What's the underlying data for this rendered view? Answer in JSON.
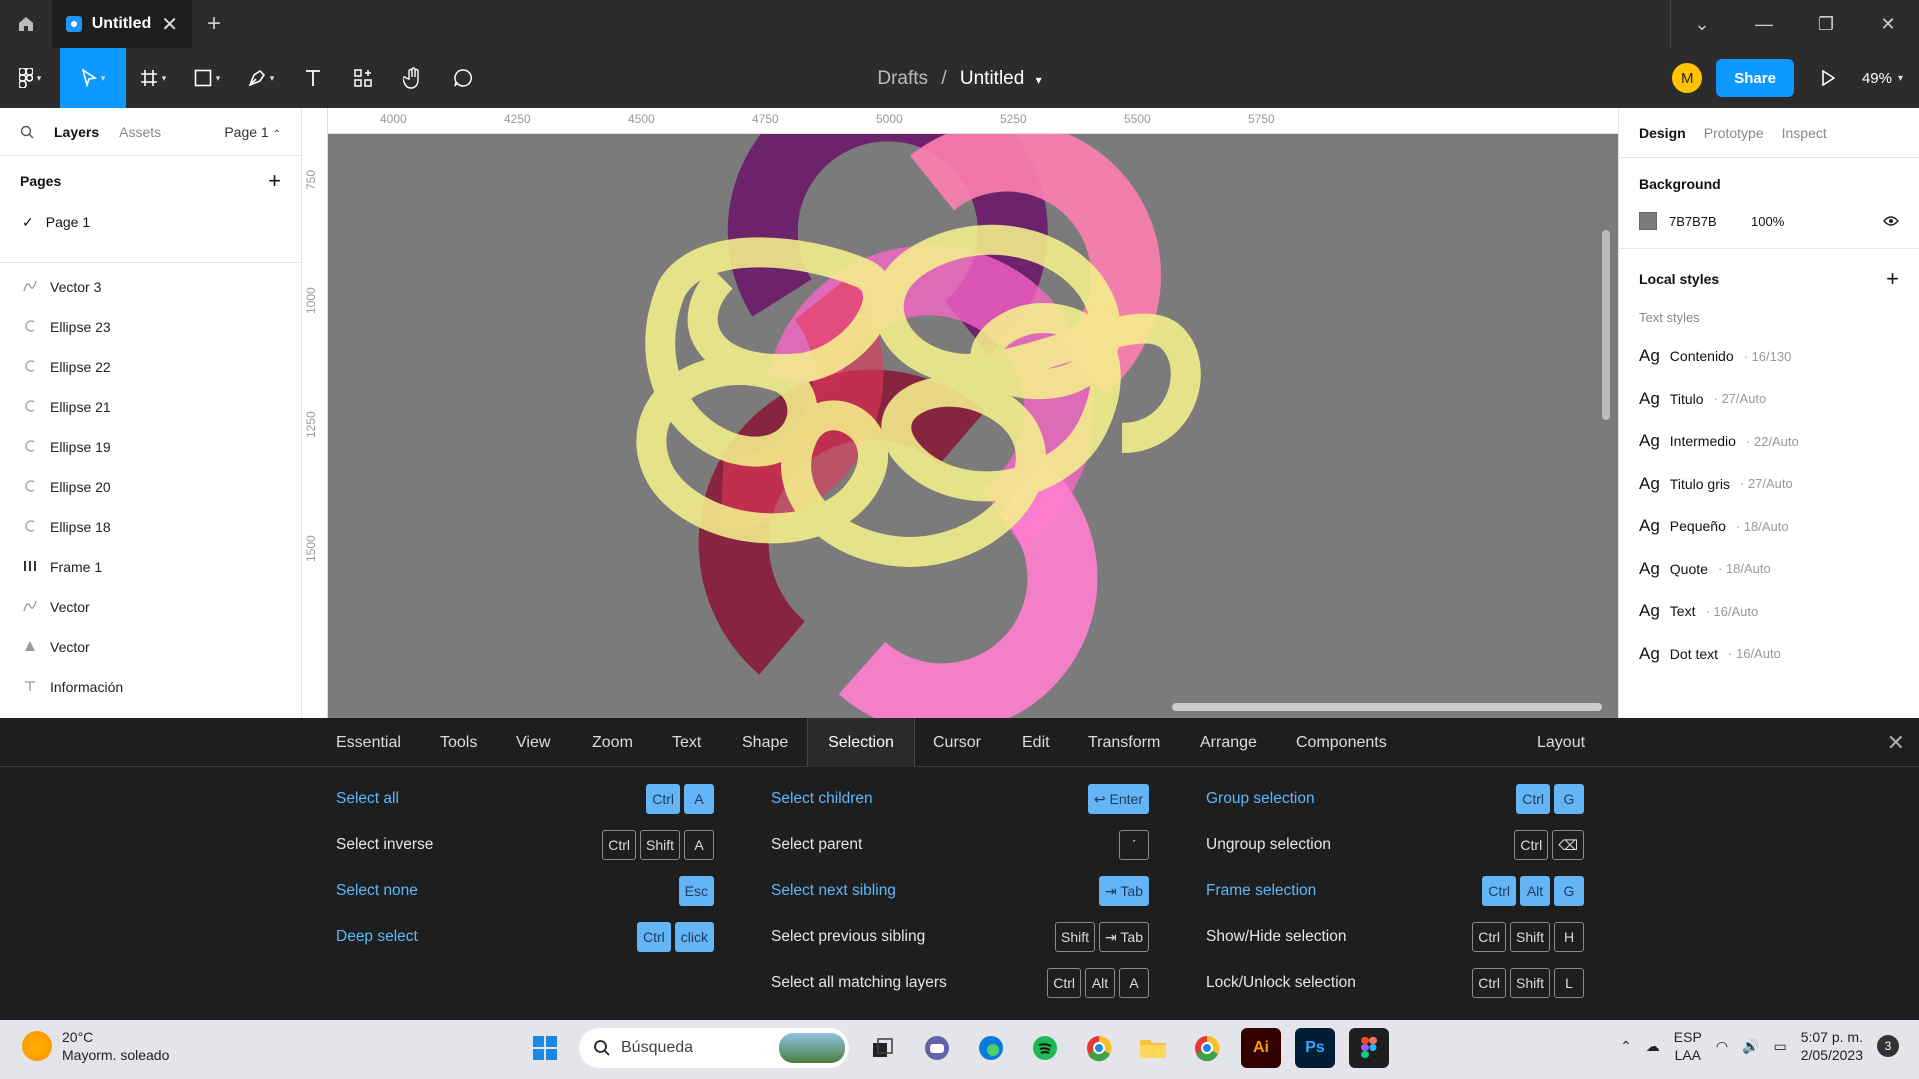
{
  "titlebar": {
    "tab_title": "Untitled",
    "close_glyph": "✕",
    "add_glyph": "+"
  },
  "toolbar": {
    "breadcrumb_parent": "Drafts",
    "breadcrumb_sep": "/",
    "file_name": "Untitled",
    "avatar_initial": "M",
    "share_label": "Share",
    "zoom": "49%"
  },
  "left_panel": {
    "tabs": {
      "layers": "Layers",
      "assets": "Assets",
      "page_selector": "Page 1"
    },
    "pages_heading": "Pages",
    "pages": [
      "Page 1"
    ],
    "layers": [
      {
        "name": "Vector 3",
        "icon": "vector-icon"
      },
      {
        "name": "Ellipse 23",
        "icon": "ellipse-arc-icon"
      },
      {
        "name": "Ellipse 22",
        "icon": "ellipse-arc-icon"
      },
      {
        "name": "Ellipse 21",
        "icon": "ellipse-arc-icon"
      },
      {
        "name": "Ellipse 19",
        "icon": "ellipse-arc-icon"
      },
      {
        "name": "Ellipse 20",
        "icon": "ellipse-arc-icon"
      },
      {
        "name": "Ellipse 18",
        "icon": "ellipse-arc-icon"
      },
      {
        "name": "Frame 1",
        "icon": "frame-icon"
      },
      {
        "name": "Vector",
        "icon": "vector-icon"
      },
      {
        "name": "Vector",
        "icon": "triangle-icon"
      },
      {
        "name": "Información",
        "icon": "text-icon"
      }
    ]
  },
  "canvas": {
    "background": "#7b7b7b",
    "ruler_top": [
      "4000",
      "4250",
      "4500",
      "4750",
      "5000",
      "5250",
      "5500",
      "5750"
    ],
    "ruler_left": [
      "750",
      "1000",
      "1250",
      "1500"
    ]
  },
  "right_panel": {
    "tabs": {
      "design": "Design",
      "prototype": "Prototype",
      "inspect": "Inspect"
    },
    "background_heading": "Background",
    "background_hex": "7B7B7B",
    "background_opacity": "100%",
    "local_styles_heading": "Local styles",
    "text_styles_heading": "Text styles",
    "styles": [
      {
        "ag": "Ag",
        "name": "Contenido",
        "meta": "· 16/130"
      },
      {
        "ag": "Ag",
        "name": "Titulo",
        "meta": "· 27/Auto"
      },
      {
        "ag": "Ag",
        "name": "Intermedio",
        "meta": "· 22/Auto"
      },
      {
        "ag": "Ag",
        "name": "Titulo gris",
        "meta": "· 27/Auto"
      },
      {
        "ag": "Ag",
        "name": "Pequeño",
        "meta": "· 18/Auto"
      },
      {
        "ag": "Ag",
        "name": "Quote",
        "meta": "· 18/Auto"
      },
      {
        "ag": "Ag",
        "name": "Text",
        "meta": "· 16/Auto"
      },
      {
        "ag": "Ag",
        "name": "Dot text",
        "meta": "· 16/Auto"
      }
    ]
  },
  "shortcuts": {
    "tabs": [
      "Essential",
      "Tools",
      "View",
      "Zoom",
      "Text",
      "Shape",
      "Selection",
      "Cursor",
      "Edit",
      "Transform",
      "Arrange",
      "Components",
      "Layout"
    ],
    "active_tab": "Selection",
    "items": [
      {
        "label": "Select all",
        "keys": [
          "Ctrl",
          "A"
        ],
        "hl": true
      },
      {
        "label": "Select inverse",
        "keys": [
          "Ctrl",
          "Shift",
          "A"
        ],
        "hl": false
      },
      {
        "label": "Select none",
        "keys": [
          "Esc"
        ],
        "hl": true
      },
      {
        "label": "Deep select",
        "keys": [
          "Ctrl",
          "click"
        ],
        "hl": true
      },
      {
        "label": "Select children",
        "keys": [
          "↩ Enter"
        ],
        "hl": true
      },
      {
        "label": "Select parent",
        "keys": [
          "ˊ"
        ],
        "hl": false
      },
      {
        "label": "Select next sibling",
        "keys": [
          "⇥ Tab"
        ],
        "hl": true
      },
      {
        "label": "Select previous sibling",
        "keys": [
          "Shift",
          "⇥ Tab"
        ],
        "hl": false
      },
      {
        "label": "Select all matching layers",
        "keys": [
          "Ctrl",
          "Alt",
          "A"
        ],
        "hl": false
      },
      {
        "label": "Group selection",
        "keys": [
          "Ctrl",
          "G"
        ],
        "hl": true
      },
      {
        "label": "Ungroup selection",
        "keys": [
          "Ctrl",
          "⌫"
        ],
        "hl": false
      },
      {
        "label": "Frame selection",
        "keys": [
          "Ctrl",
          "Alt",
          "G"
        ],
        "hl": true
      },
      {
        "label": "Show/Hide selection",
        "keys": [
          "Ctrl",
          "Shift",
          "H"
        ],
        "hl": false
      },
      {
        "label": "Lock/Unlock selection",
        "keys": [
          "Ctrl",
          "Shift",
          "L"
        ],
        "hl": false
      }
    ]
  },
  "taskbar": {
    "temperature": "20°C",
    "weather": "Mayorm. soleado",
    "search_placeholder": "Búsqueda",
    "lang_top": "ESP",
    "lang_bottom": "LAA",
    "time": "5:07 p. m.",
    "date": "2/05/2023",
    "notif_count": "3"
  }
}
